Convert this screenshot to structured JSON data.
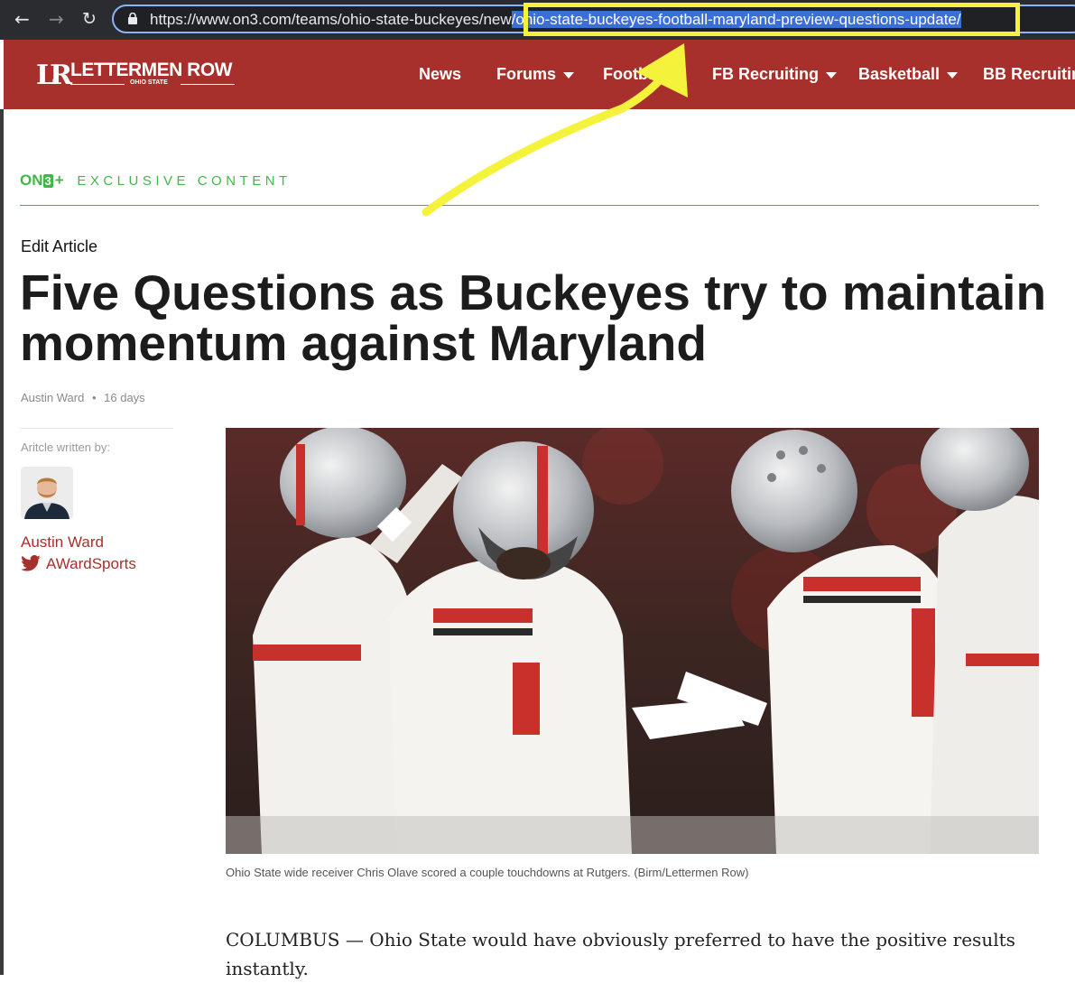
{
  "browser": {
    "url_prefix": "https://www.on3.com/teams/ohio-state-buckeyes/new",
    "url_selected": "/ohio-state-buckeyes-football-maryland-preview-questions-update/",
    "back_icon": "back-arrow-icon",
    "forward_icon": "forward-arrow-icon",
    "reload_icon": "reload-icon"
  },
  "site": {
    "logo_mark": "LR",
    "logo_text": "LETTERMEN ROW",
    "logo_subtext": "OHIO STATE",
    "nav": [
      "News",
      "Forums",
      "Football",
      "FB Recruiting",
      "Basketball",
      "BB Recruiting"
    ],
    "brand_color": "#a8302c"
  },
  "article": {
    "exclusive_logo_on": "ON",
    "exclusive_logo_3": "3",
    "exclusive_logo_plus": "+",
    "exclusive_label": "EXCLUSIVE CONTENT",
    "edit_link": "Edit Article",
    "headline": "Five Questions as Buckeyes try to maintain momentum against Maryland",
    "author": "Austin Ward",
    "separator": "•",
    "age": "16 days",
    "written_by_label": "Aritcle written by:",
    "author_name": "Austin Ward",
    "author_twitter": "AWardSports",
    "photo_caption": "Ohio State wide receiver Chris Olave scored a couple touchdowns at Rutgers. (Birm/Lettermen Row)",
    "body_text": "COLUMBUS — Ohio State would have obviously preferred to have the positive results instantly."
  },
  "annotation": {
    "highlight_color": "#f5f23c"
  }
}
